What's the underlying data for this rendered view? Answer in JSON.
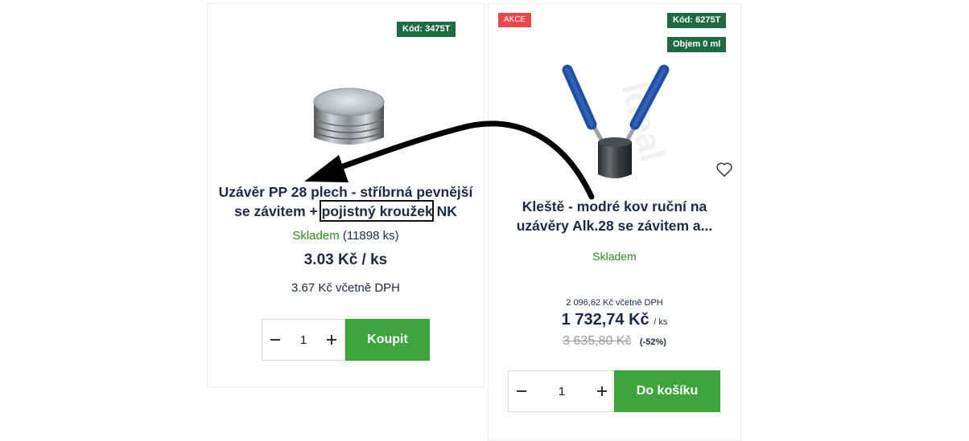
{
  "products": [
    {
      "code_badge": "Kód: 3475T",
      "image_alt": "silver screw cap",
      "title_line1": "Uzávěr PP 28 plech - stříbrná pevnější",
      "title_line2_pre": "se závitem + ",
      "title_line2_highlight": "pojistný kroužek",
      "title_line2_post": " NK",
      "stock_status": "Skladem",
      "stock_count": " (11898 ks)",
      "price": "3.03 Kč / ks",
      "price_vat": "3.67 Kč včetně DPH",
      "quantity": "1",
      "buy_label": "Koupit"
    },
    {
      "sale_badge": "AKCE",
      "code_badge": "Kód: 6275T",
      "volume_badge": "Objem 0 ml",
      "title_line1": "Kleště - modré kov ruční na",
      "title_line2": "uzávěry Alk.28 se závitem a...",
      "stock_status": "Skladem",
      "price_vat": "2 096,62 Kč včetně DPH",
      "price": "1 732,74 Kč",
      "price_unit": "/ ks",
      "price_old": "3 635,80 Kč",
      "discount": "(-52%)",
      "quantity": "1",
      "buy_label": "Do košíku"
    }
  ],
  "colors": {
    "badge_green": "#1d6b44",
    "badge_red": "#e8474b",
    "button_green": "#3ea53e",
    "stock_green": "#2d8a1e",
    "title_navy": "#1d2a44"
  },
  "icons": [
    "minus-icon",
    "plus-icon",
    "heart-icon",
    "annotation-arrow"
  ]
}
